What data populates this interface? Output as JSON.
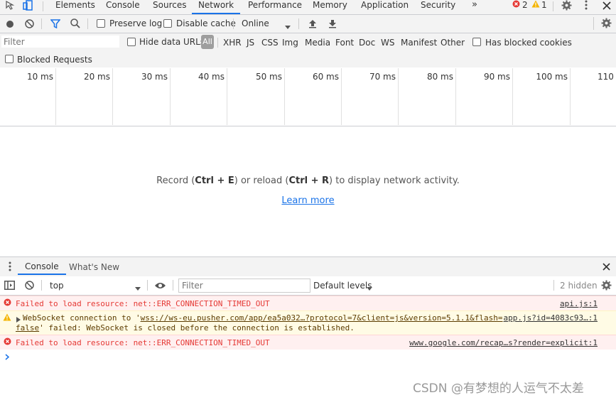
{
  "devtools": {
    "tabs": [
      {
        "label": "Elements"
      },
      {
        "label": "Console"
      },
      {
        "label": "Sources"
      },
      {
        "label": "Network",
        "active": true
      },
      {
        "label": "Performance"
      },
      {
        "label": "Memory"
      },
      {
        "label": "Application"
      },
      {
        "label": "Security"
      }
    ],
    "more_tabs": "»",
    "error_count": "2",
    "warning_count": "1"
  },
  "network_toolbar": {
    "preserve_log": "Preserve log",
    "disable_cache": "Disable cache",
    "throttling": "Online"
  },
  "filter_bar": {
    "placeholder": "Filter",
    "hide_data_urls": "Hide data URLs",
    "types": [
      "All",
      "XHR",
      "JS",
      "CSS",
      "Img",
      "Media",
      "Font",
      "Doc",
      "WS",
      "Manifest",
      "Other"
    ],
    "has_blocked_cookies": "Has blocked cookies",
    "blocked_requests": "Blocked Requests"
  },
  "timeline": {
    "ticks": [
      "10 ms",
      "20 ms",
      "30 ms",
      "40 ms",
      "50 ms",
      "60 ms",
      "70 ms",
      "80 ms",
      "90 ms",
      "100 ms",
      "110 ms"
    ]
  },
  "empty_state": {
    "record_prefix": "Record (",
    "record_keys": "Ctrl + E",
    "middle": ") or reload (",
    "reload_keys": "Ctrl + R",
    "suffix": ") to display network activity.",
    "learn_more": "Learn more"
  },
  "drawer": {
    "tabs": [
      "Console",
      "What's New"
    ],
    "context": "top",
    "filter_placeholder": "Filter",
    "levels": "Default levels",
    "hidden": "2 hidden"
  },
  "console_messages": [
    {
      "level": "error",
      "text": "Failed to load resource: net::ERR_CONNECTION_TIMED_OUT",
      "source": "api.js:1"
    },
    {
      "level": "warning",
      "prefix": "WebSocket connection to '",
      "url": "wss://ws-eu.pusher.com/app/ea5a032…?protocol=7&client=js&version=5.1.1&flash=",
      "url_cont": "false",
      "suffix": "' failed: WebSocket is closed before the connection is established.",
      "source": "app.js?id=4083c93…:1"
    },
    {
      "level": "error",
      "text": "Failed to load resource: net::ERR_CONNECTION_TIMED_OUT",
      "source": "www.google.com/recap…s?render=explicit:1"
    }
  ],
  "watermark": "CSDN @有梦想的人运气不太差",
  "colors": {
    "accent": "#1a73e8",
    "error": "#e53935",
    "warning": "#f4b400",
    "toolbar_bg": "#f3f3f3"
  }
}
